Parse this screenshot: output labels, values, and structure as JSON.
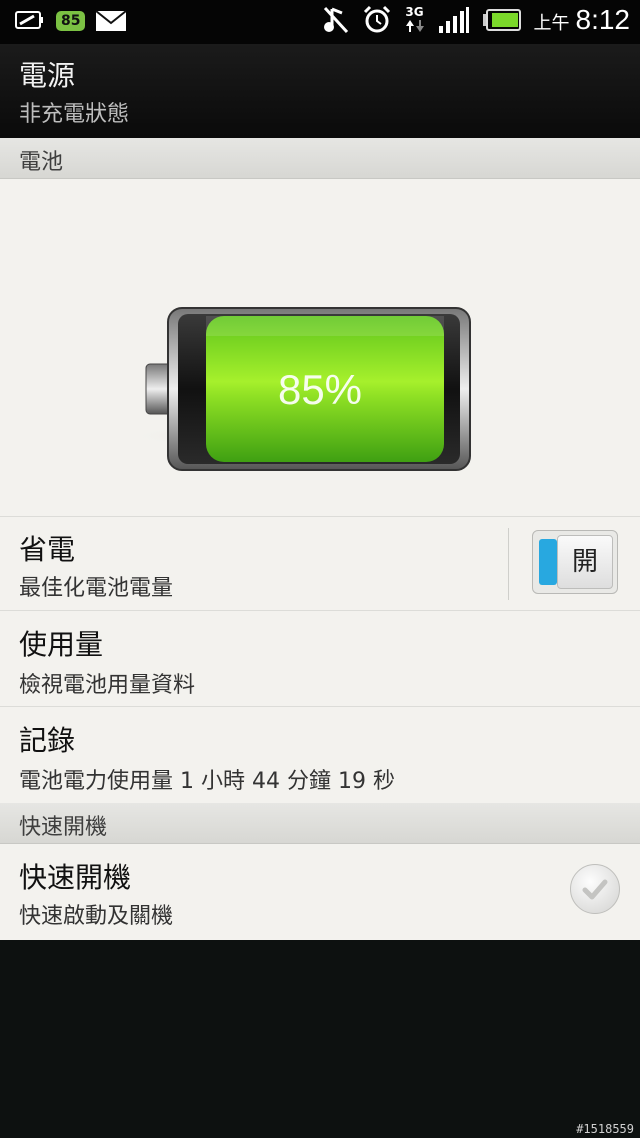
{
  "status_bar": {
    "battery_badge": "85",
    "network_type": "3G",
    "clock_ampm": "上午",
    "clock_time": "8:12",
    "icons": [
      "battery-saver-icon",
      "mail-icon",
      "mute-icon",
      "alarm-icon",
      "data-arrows-icon",
      "signal-icon",
      "battery-icon"
    ]
  },
  "header": {
    "title": "電源",
    "subtitle": "非充電狀態"
  },
  "battery_section": {
    "title": "電池",
    "percent_label": "85%",
    "level_fraction": 0.85
  },
  "power_saver": {
    "title": "省電",
    "subtitle": "最佳化電池電量",
    "toggle_label": "開"
  },
  "usage": {
    "title": "使用量",
    "subtitle": "檢視電池用量資料"
  },
  "history": {
    "title": "記錄",
    "subtitle": "電池電力使用量 1 小時 44 分鐘 19 秒"
  },
  "fast_boot_section": {
    "title": "快速開機"
  },
  "fast_boot": {
    "title": "快速開機",
    "subtitle": "快速啟動及關機",
    "checked": false
  },
  "watermark": "#1518559",
  "colors": {
    "accent_blue": "#28a8e0",
    "battery_green": "#7bd82a"
  }
}
